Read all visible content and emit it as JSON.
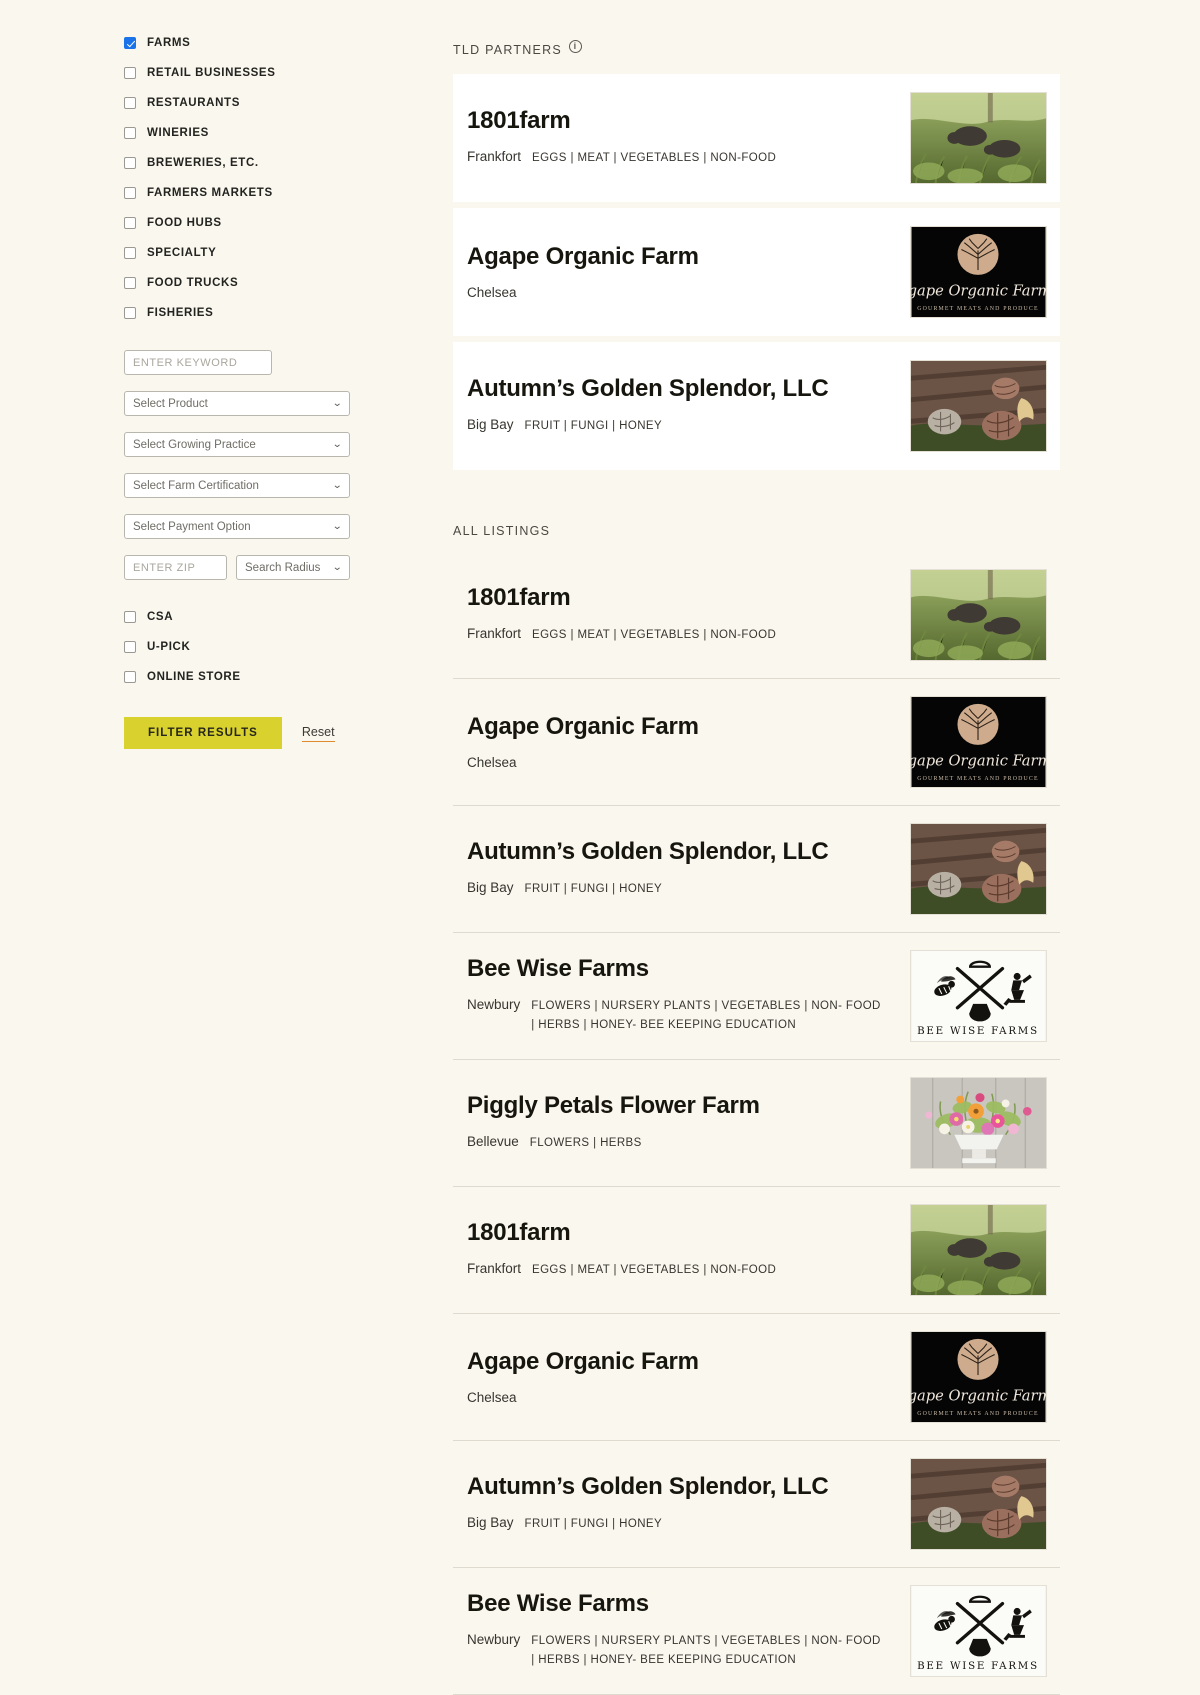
{
  "sidebar": {
    "categories": [
      {
        "label": "FARMS",
        "checked": true
      },
      {
        "label": "RETAIL BUSINESSES",
        "checked": false
      },
      {
        "label": "RESTAURANTS",
        "checked": false
      },
      {
        "label": "WINERIES",
        "checked": false
      },
      {
        "label": "BREWERIES, ETC.",
        "checked": false
      },
      {
        "label": "FARMERS MARKETS",
        "checked": false
      },
      {
        "label": "FOOD HUBS",
        "checked": false
      },
      {
        "label": "SPECIALTY",
        "checked": false
      },
      {
        "label": "FOOD TRUCKS",
        "checked": false
      },
      {
        "label": "FISHERIES",
        "checked": false
      }
    ],
    "keyword_placeholder": "ENTER KEYWORD",
    "keyword_value": "",
    "selects": [
      {
        "label": "Select Product"
      },
      {
        "label": "Select Growing Practice"
      },
      {
        "label": "Select Farm Certification"
      },
      {
        "label": "Select Payment Option"
      }
    ],
    "zip_placeholder": "ENTER ZIP",
    "zip_value": "",
    "radius_label": "Search Radius",
    "options": [
      {
        "label": "CSA",
        "checked": false
      },
      {
        "label": "U-PICK",
        "checked": false
      },
      {
        "label": "ONLINE STORE",
        "checked": false
      }
    ],
    "filter_button": "FILTER RESULTS",
    "reset_link": "Reset",
    "accent_button_color": "#d8d12e",
    "reset_underline_color": "#e08a2e",
    "checked_color": "#1a73e8"
  },
  "main": {
    "partners_heading": "TLD PARTNERS",
    "partners_info_icon": "info-icon",
    "all_heading": "ALL LISTINGS",
    "partners": [
      {
        "name": "1801farm",
        "city": "Frankfort",
        "products": "EGGS | MEAT | VEGETABLES | NON-FOOD",
        "image": "pigs-pasture-photo"
      },
      {
        "name": "Agape Organic Farm",
        "city": "Chelsea",
        "products": "",
        "image": "agape-organic-farms-logo"
      },
      {
        "name": "Autumn’s Golden Splendor, LLC",
        "city": "Big Bay",
        "products": "FRUIT | FUNGI | HONEY",
        "image": "mushrooms-on-log-photo"
      }
    ],
    "listings": [
      {
        "name": "1801farm",
        "city": "Frankfort",
        "products": "EGGS | MEAT | VEGETABLES | NON-FOOD",
        "image": "pigs-pasture-photo"
      },
      {
        "name": "Agape Organic Farm",
        "city": "Chelsea",
        "products": "",
        "image": "agape-organic-farms-logo"
      },
      {
        "name": "Autumn’s Golden Splendor, LLC",
        "city": "Big Bay",
        "products": "FRUIT | FUNGI | HONEY",
        "image": "mushrooms-on-log-photo"
      },
      {
        "name": "Bee Wise Farms",
        "city": "Newbury",
        "products": "FLOWERS | NURSERY PLANTS | VEGETABLES | NON- FOOD | HERBS | HONEY- BEE KEEPING EDUCATION",
        "image": "bee-wise-farms-logo"
      },
      {
        "name": "Piggly Petals Flower Farm",
        "city": "Bellevue",
        "products": "FLOWERS | HERBS",
        "image": "flower-bouquet-photo"
      },
      {
        "name": "1801farm",
        "city": "Frankfort",
        "products": "EGGS | MEAT | VEGETABLES | NON-FOOD",
        "image": "pigs-pasture-photo"
      },
      {
        "name": "Agape Organic Farm",
        "city": "Chelsea",
        "products": "",
        "image": "agape-organic-farms-logo"
      },
      {
        "name": "Autumn’s Golden Splendor, LLC",
        "city": "Big Bay",
        "products": "FRUIT | FUNGI | HONEY",
        "image": "mushrooms-on-log-photo"
      },
      {
        "name": "Bee Wise Farms",
        "city": "Newbury",
        "products": "FLOWERS | NURSERY PLANTS | VEGETABLES | NON- FOOD | HERBS | HONEY- BEE KEEPING EDUCATION",
        "image": "bee-wise-farms-logo"
      }
    ]
  }
}
